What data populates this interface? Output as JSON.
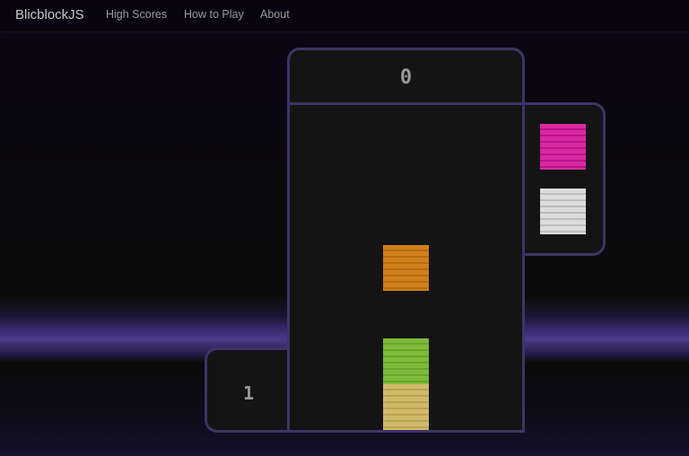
{
  "nav": {
    "brand": "BlicblockJS",
    "links": [
      {
        "label": "High Scores"
      },
      {
        "label": "How to Play"
      },
      {
        "label": "About"
      }
    ]
  },
  "game": {
    "score": "0",
    "level": "1",
    "board_blocks": [
      {
        "color": "orange",
        "hex": "#d0801c"
      },
      {
        "color": "green",
        "hex": "#7ebb3a"
      },
      {
        "color": "tan",
        "hex": "#d1b96a"
      }
    ],
    "next_blocks": [
      {
        "color": "magenta",
        "hex": "#d92aa2"
      },
      {
        "color": "white",
        "hex": "#dcdcdc"
      }
    ]
  },
  "colors": {
    "panel_border": "#3f3466",
    "panel_background": "#141414",
    "text": "#9a9a9a"
  }
}
